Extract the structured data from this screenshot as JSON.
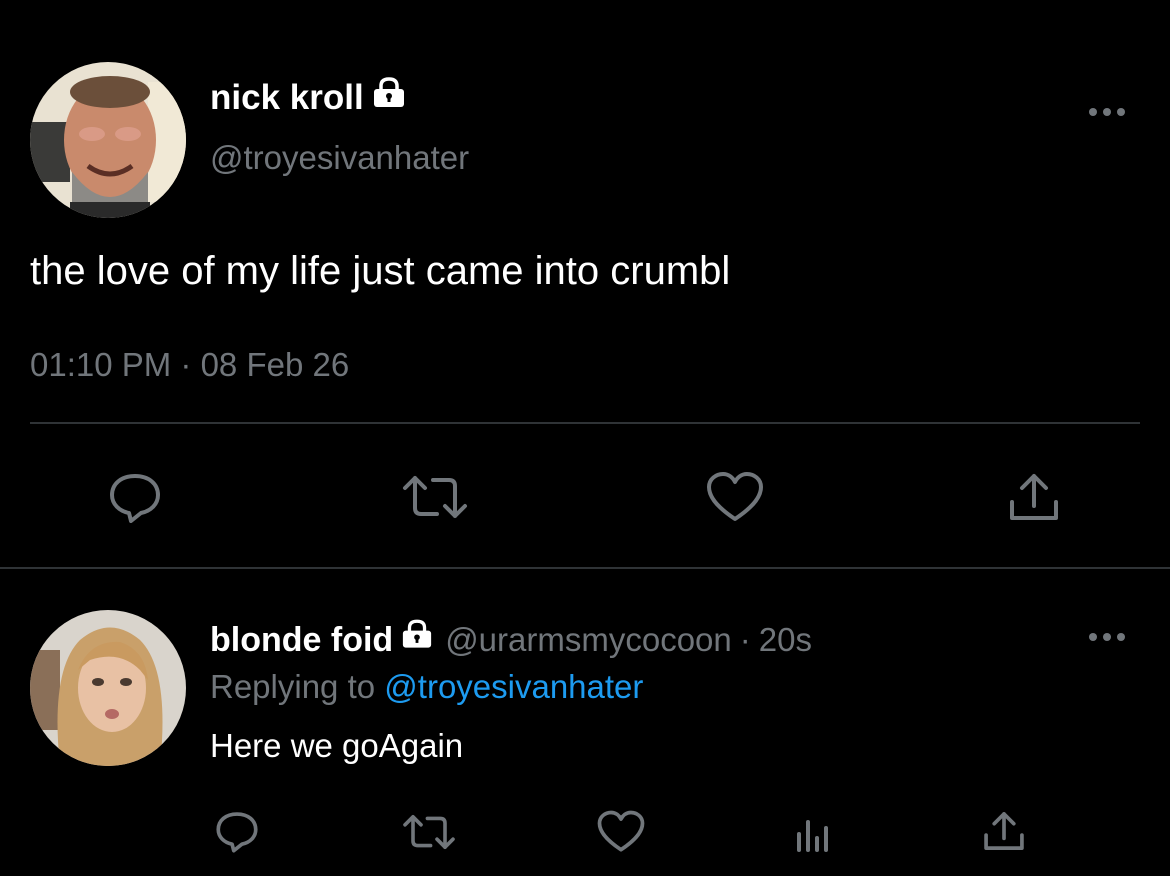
{
  "colors": {
    "background": "#000000",
    "primary_text": "#ffffff",
    "secondary_text": "#71767b",
    "link": "#1d9bf0",
    "divider": "#2f3336",
    "icon": "#71767b"
  },
  "main_tweet": {
    "display_name": "nick kroll",
    "handle": "@troyesivanhater",
    "protected_icon": "lock-icon",
    "text": "the love of my life just came into crumbl",
    "timestamp": "01:10 PM · 08 Feb 26",
    "more_icon": "more-options-icon",
    "actions": [
      {
        "name": "reply",
        "icon": "comment-icon"
      },
      {
        "name": "retweet",
        "icon": "retweet-icon"
      },
      {
        "name": "like",
        "icon": "heart-icon"
      },
      {
        "name": "share",
        "icon": "share-icon"
      }
    ]
  },
  "reply_tweet": {
    "display_name": "blonde foid",
    "handle": "@urarmsmycocoon",
    "separator": "·",
    "time_ago": "20s",
    "protected_icon": "lock-icon",
    "replying_label": "Replying to",
    "replying_to": "@troyesivanhater",
    "text": "Here we goAgain",
    "more_icon": "more-options-icon",
    "actions": [
      {
        "name": "reply",
        "icon": "comment-icon"
      },
      {
        "name": "retweet",
        "icon": "retweet-icon"
      },
      {
        "name": "like",
        "icon": "heart-icon"
      },
      {
        "name": "analytics",
        "icon": "analytics-icon"
      },
      {
        "name": "share",
        "icon": "share-icon"
      }
    ]
  }
}
